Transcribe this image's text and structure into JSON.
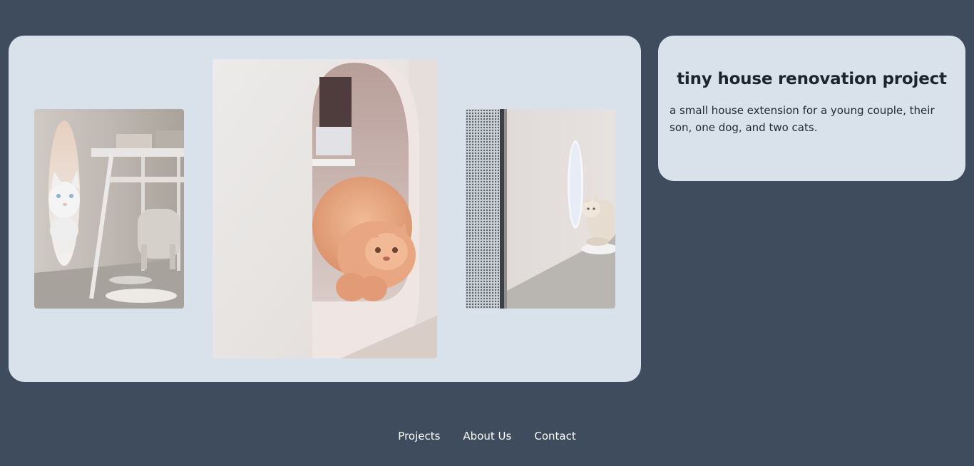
{
  "colors": {
    "page_background": "#3e4c5e",
    "card_background": "#d9e1ea",
    "title_text": "#1c2430",
    "body_text": "#222a35",
    "footer_link": "#ffffff"
  },
  "gallery": {
    "photos": [
      {
        "name": "white cat peeking through oval opening",
        "icon": "photo-cat-white-icon"
      },
      {
        "name": "orange persian cat stepping out of round opening",
        "icon": "photo-cat-orange-icon"
      },
      {
        "name": "cream cat beside oval opening near mesh door",
        "icon": "photo-cat-cream-icon"
      }
    ]
  },
  "project": {
    "title": "tiny house renovation project",
    "description": "a small house extension for a young couple, their son, one dog, and two cats."
  },
  "footer": {
    "links": [
      {
        "label": "Projects"
      },
      {
        "label": "About Us"
      },
      {
        "label": "Contact"
      }
    ]
  }
}
